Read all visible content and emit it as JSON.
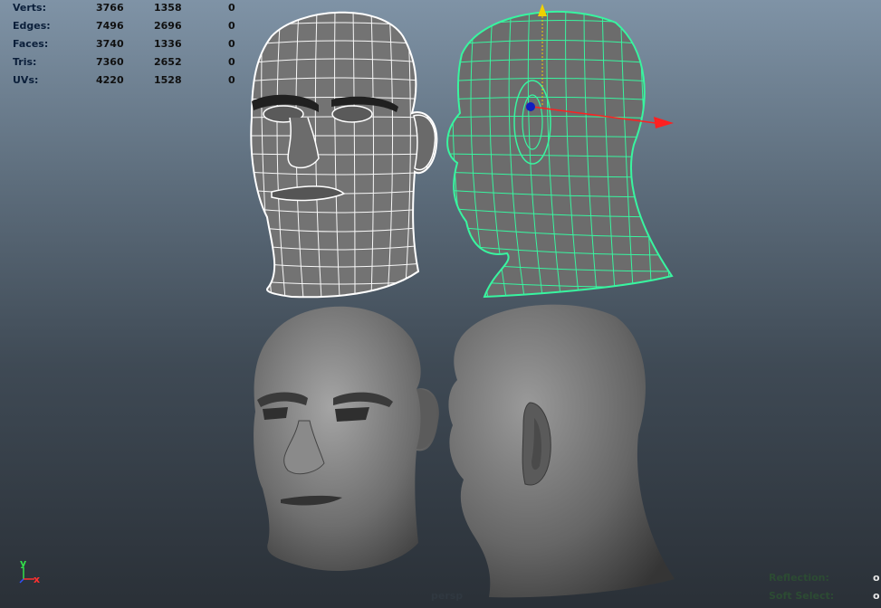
{
  "hud": {
    "rows": [
      {
        "label": "Verts:",
        "a": "3766",
        "b": "1358",
        "c": "0"
      },
      {
        "label": "Edges:",
        "a": "7496",
        "b": "2696",
        "c": "0"
      },
      {
        "label": "Faces:",
        "a": "3740",
        "b": "1336",
        "c": "0"
      },
      {
        "label": "Tris:",
        "a": "7360",
        "b": "2652",
        "c": "0"
      },
      {
        "label": "UVs:",
        "a": "4220",
        "b": "1528",
        "c": "0"
      }
    ]
  },
  "axis": {
    "y": "y",
    "x": "x"
  },
  "camera_label": "persp",
  "status": {
    "reflection_label": "Reflection:",
    "reflection_value": "o",
    "soft_select_label": "Soft Select:",
    "soft_select_value": "o"
  },
  "colors": {
    "wire_white": "#ffffff",
    "wire_selected": "#38f5a0",
    "mesh_gray": "#7b7b7b",
    "manip_x": "#ff2020",
    "manip_y": "#f0d000",
    "manip_center": "#1020c0"
  }
}
